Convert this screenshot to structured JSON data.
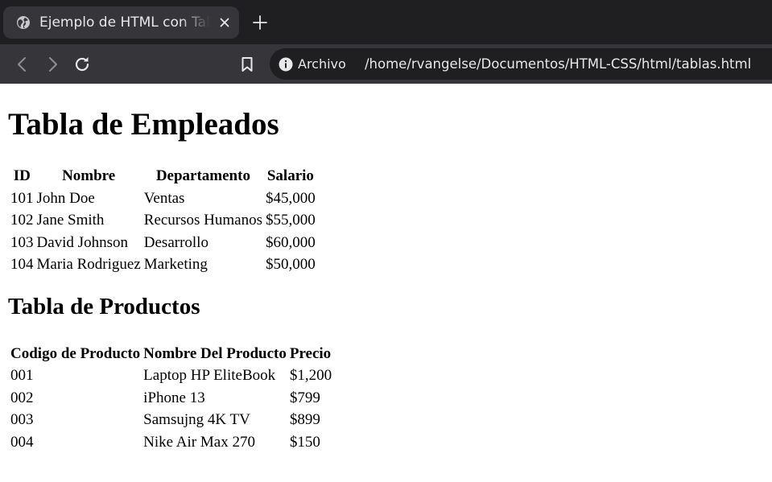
{
  "browser": {
    "tab": {
      "title": "Ejemplo de HTML con Tablas",
      "favicon": "globe-icon"
    },
    "address_bar": {
      "scheme_label": "Archivo",
      "url": "/home/rvangelse/Documentos/HTML-CSS/html/tablas.html"
    },
    "icons": {
      "back": "arrow-left-icon",
      "forward": "arrow-right-icon",
      "reload": "reload-icon",
      "bookmark": "bookmark-icon",
      "info": "info-icon",
      "close": "close-icon",
      "new_tab": "plus-icon"
    },
    "colors": {
      "tabbar_bg": "#1f1f22",
      "toolbar_bg": "#36363a",
      "text": "#e8e8ea"
    }
  },
  "page": {
    "heading_main": "Tabla de Empleados",
    "employees": {
      "headers": [
        "ID",
        "Nombre",
        "Departamento",
        "Salario"
      ],
      "rows": [
        [
          "101",
          "John Doe",
          "Ventas",
          "$45,000"
        ],
        [
          "102",
          "Jane Smith",
          "Recursos Humanos",
          "$55,000"
        ],
        [
          "103",
          "David Johnson",
          "Desarrollo",
          "$60,000"
        ],
        [
          "104",
          "Maria Rodriguez",
          "Marketing",
          "$50,000"
        ]
      ]
    },
    "heading_products": "Tabla de Productos",
    "products": {
      "headers": [
        "Codigo de Producto",
        "Nombre Del Producto",
        "Precio"
      ],
      "rows": [
        [
          "001",
          "Laptop HP EliteBook",
          "$1,200"
        ],
        [
          "002",
          "iPhone 13",
          "$799"
        ],
        [
          "003",
          "Samsujng 4K TV",
          "$899"
        ],
        [
          "004",
          "Nike Air Max 270",
          "$150"
        ]
      ]
    }
  }
}
